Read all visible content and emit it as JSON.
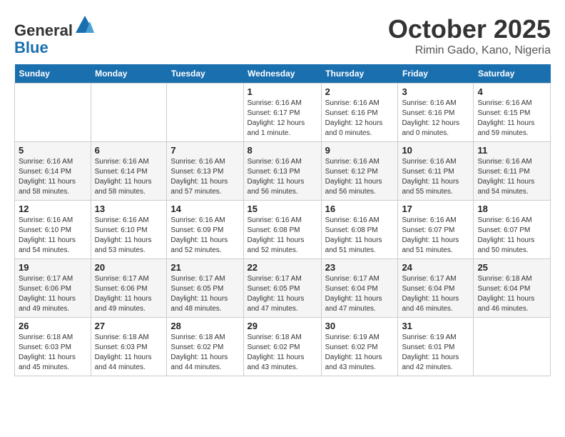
{
  "header": {
    "logo_line1": "General",
    "logo_line2": "Blue",
    "month_year": "October 2025",
    "location": "Rimin Gado, Kano, Nigeria"
  },
  "calendar": {
    "days_of_week": [
      "Sunday",
      "Monday",
      "Tuesday",
      "Wednesday",
      "Thursday",
      "Friday",
      "Saturday"
    ],
    "weeks": [
      [
        {
          "date": "",
          "info": ""
        },
        {
          "date": "",
          "info": ""
        },
        {
          "date": "",
          "info": ""
        },
        {
          "date": "1",
          "info": "Sunrise: 6:16 AM\nSunset: 6:17 PM\nDaylight: 12 hours\nand 1 minute."
        },
        {
          "date": "2",
          "info": "Sunrise: 6:16 AM\nSunset: 6:16 PM\nDaylight: 12 hours\nand 0 minutes."
        },
        {
          "date": "3",
          "info": "Sunrise: 6:16 AM\nSunset: 6:16 PM\nDaylight: 12 hours\nand 0 minutes."
        },
        {
          "date": "4",
          "info": "Sunrise: 6:16 AM\nSunset: 6:15 PM\nDaylight: 11 hours\nand 59 minutes."
        }
      ],
      [
        {
          "date": "5",
          "info": "Sunrise: 6:16 AM\nSunset: 6:14 PM\nDaylight: 11 hours\nand 58 minutes."
        },
        {
          "date": "6",
          "info": "Sunrise: 6:16 AM\nSunset: 6:14 PM\nDaylight: 11 hours\nand 58 minutes."
        },
        {
          "date": "7",
          "info": "Sunrise: 6:16 AM\nSunset: 6:13 PM\nDaylight: 11 hours\nand 57 minutes."
        },
        {
          "date": "8",
          "info": "Sunrise: 6:16 AM\nSunset: 6:13 PM\nDaylight: 11 hours\nand 56 minutes."
        },
        {
          "date": "9",
          "info": "Sunrise: 6:16 AM\nSunset: 6:12 PM\nDaylight: 11 hours\nand 56 minutes."
        },
        {
          "date": "10",
          "info": "Sunrise: 6:16 AM\nSunset: 6:11 PM\nDaylight: 11 hours\nand 55 minutes."
        },
        {
          "date": "11",
          "info": "Sunrise: 6:16 AM\nSunset: 6:11 PM\nDaylight: 11 hours\nand 54 minutes."
        }
      ],
      [
        {
          "date": "12",
          "info": "Sunrise: 6:16 AM\nSunset: 6:10 PM\nDaylight: 11 hours\nand 54 minutes."
        },
        {
          "date": "13",
          "info": "Sunrise: 6:16 AM\nSunset: 6:10 PM\nDaylight: 11 hours\nand 53 minutes."
        },
        {
          "date": "14",
          "info": "Sunrise: 6:16 AM\nSunset: 6:09 PM\nDaylight: 11 hours\nand 52 minutes."
        },
        {
          "date": "15",
          "info": "Sunrise: 6:16 AM\nSunset: 6:08 PM\nDaylight: 11 hours\nand 52 minutes."
        },
        {
          "date": "16",
          "info": "Sunrise: 6:16 AM\nSunset: 6:08 PM\nDaylight: 11 hours\nand 51 minutes."
        },
        {
          "date": "17",
          "info": "Sunrise: 6:16 AM\nSunset: 6:07 PM\nDaylight: 11 hours\nand 51 minutes."
        },
        {
          "date": "18",
          "info": "Sunrise: 6:16 AM\nSunset: 6:07 PM\nDaylight: 11 hours\nand 50 minutes."
        }
      ],
      [
        {
          "date": "19",
          "info": "Sunrise: 6:17 AM\nSunset: 6:06 PM\nDaylight: 11 hours\nand 49 minutes."
        },
        {
          "date": "20",
          "info": "Sunrise: 6:17 AM\nSunset: 6:06 PM\nDaylight: 11 hours\nand 49 minutes."
        },
        {
          "date": "21",
          "info": "Sunrise: 6:17 AM\nSunset: 6:05 PM\nDaylight: 11 hours\nand 48 minutes."
        },
        {
          "date": "22",
          "info": "Sunrise: 6:17 AM\nSunset: 6:05 PM\nDaylight: 11 hours\nand 47 minutes."
        },
        {
          "date": "23",
          "info": "Sunrise: 6:17 AM\nSunset: 6:04 PM\nDaylight: 11 hours\nand 47 minutes."
        },
        {
          "date": "24",
          "info": "Sunrise: 6:17 AM\nSunset: 6:04 PM\nDaylight: 11 hours\nand 46 minutes."
        },
        {
          "date": "25",
          "info": "Sunrise: 6:18 AM\nSunset: 6:04 PM\nDaylight: 11 hours\nand 46 minutes."
        }
      ],
      [
        {
          "date": "26",
          "info": "Sunrise: 6:18 AM\nSunset: 6:03 PM\nDaylight: 11 hours\nand 45 minutes."
        },
        {
          "date": "27",
          "info": "Sunrise: 6:18 AM\nSunset: 6:03 PM\nDaylight: 11 hours\nand 44 minutes."
        },
        {
          "date": "28",
          "info": "Sunrise: 6:18 AM\nSunset: 6:02 PM\nDaylight: 11 hours\nand 44 minutes."
        },
        {
          "date": "29",
          "info": "Sunrise: 6:18 AM\nSunset: 6:02 PM\nDaylight: 11 hours\nand 43 minutes."
        },
        {
          "date": "30",
          "info": "Sunrise: 6:19 AM\nSunset: 6:02 PM\nDaylight: 11 hours\nand 43 minutes."
        },
        {
          "date": "31",
          "info": "Sunrise: 6:19 AM\nSunset: 6:01 PM\nDaylight: 11 hours\nand 42 minutes."
        },
        {
          "date": "",
          "info": ""
        }
      ]
    ]
  }
}
